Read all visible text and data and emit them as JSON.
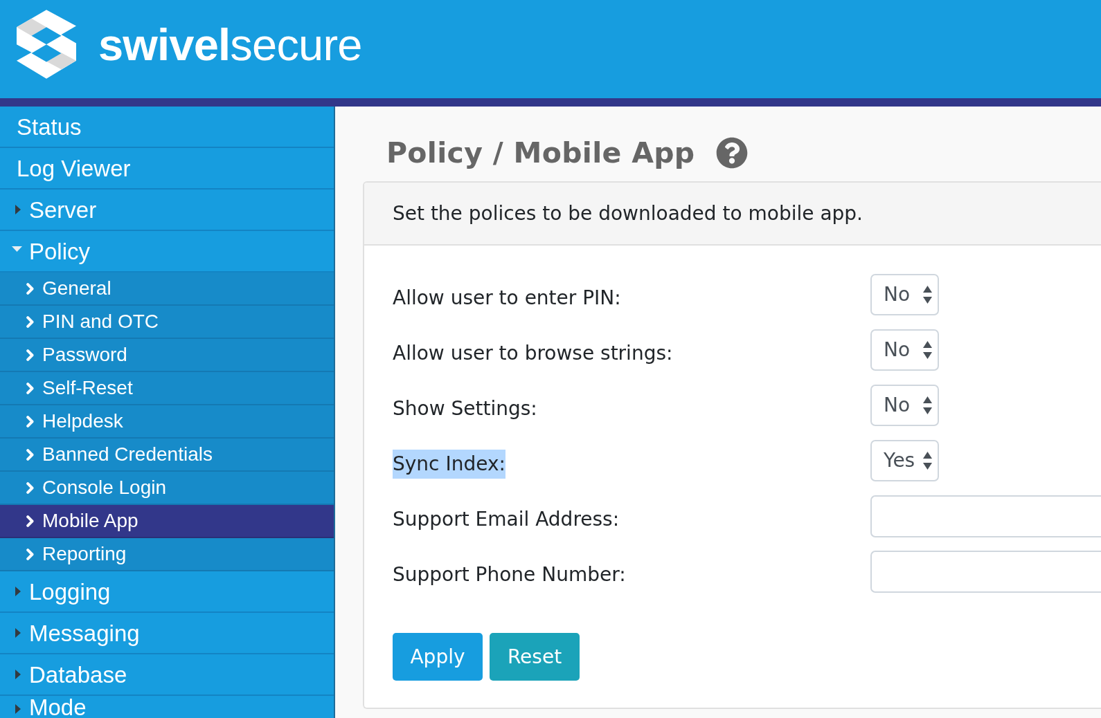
{
  "header": {
    "logo_text": "**swivel**secure"
  },
  "sidebar": {
    "items": [
      {
        "kind": "link",
        "label": "Status",
        "selected": false
      },
      {
        "kind": "link",
        "label": "Log Viewer",
        "selected": false
      },
      {
        "kind": "group",
        "label": "Server",
        "expanded": false,
        "selected": false
      },
      {
        "kind": "group",
        "label": "Policy",
        "expanded": true,
        "selected": false,
        "children": [
          {
            "label": "General",
            "selected": false
          },
          {
            "label": "PIN and OTC",
            "selected": false
          },
          {
            "label": "Password",
            "selected": false
          },
          {
            "label": "Self-Reset",
            "selected": false
          },
          {
            "label": "Helpdesk",
            "selected": false
          },
          {
            "label": "Banned Credentials",
            "selected": false
          },
          {
            "label": "Console Login",
            "selected": false
          },
          {
            "label": "Mobile App",
            "selected": true
          },
          {
            "label": "Reporting",
            "selected": false
          }
        ]
      },
      {
        "kind": "group",
        "label": "Logging",
        "expanded": false,
        "selected": false
      },
      {
        "kind": "group",
        "label": "Messaging",
        "expanded": false,
        "selected": false
      },
      {
        "kind": "group",
        "label": "Database",
        "expanded": false,
        "selected": false
      },
      {
        "kind": "group",
        "label": "Mode",
        "expanded": false,
        "selected": false
      }
    ]
  },
  "page": {
    "title": "Policy / Mobile App"
  },
  "panel": {
    "description": "Set the polices to be downloaded to mobile app.",
    "fields": [
      {
        "kind": "select",
        "label": "Allow user to enter PIN:",
        "value": "No",
        "highlighted": false
      },
      {
        "kind": "select",
        "label": "Allow user to browse strings:",
        "value": "No",
        "highlighted": false
      },
      {
        "kind": "select",
        "label": "Show Settings:",
        "value": "No",
        "highlighted": false
      },
      {
        "kind": "select",
        "label": "Sync Index:",
        "value": "Yes",
        "highlighted": true
      },
      {
        "kind": "text",
        "label": "Support Email Address:",
        "highlighted": false
      },
      {
        "kind": "text",
        "label": "Support Phone Number:",
        "highlighted": false
      }
    ],
    "buttons": [
      {
        "kind": "submit",
        "label": "Apply"
      },
      {
        "kind": "reset",
        "label": "Reset"
      }
    ]
  }
}
